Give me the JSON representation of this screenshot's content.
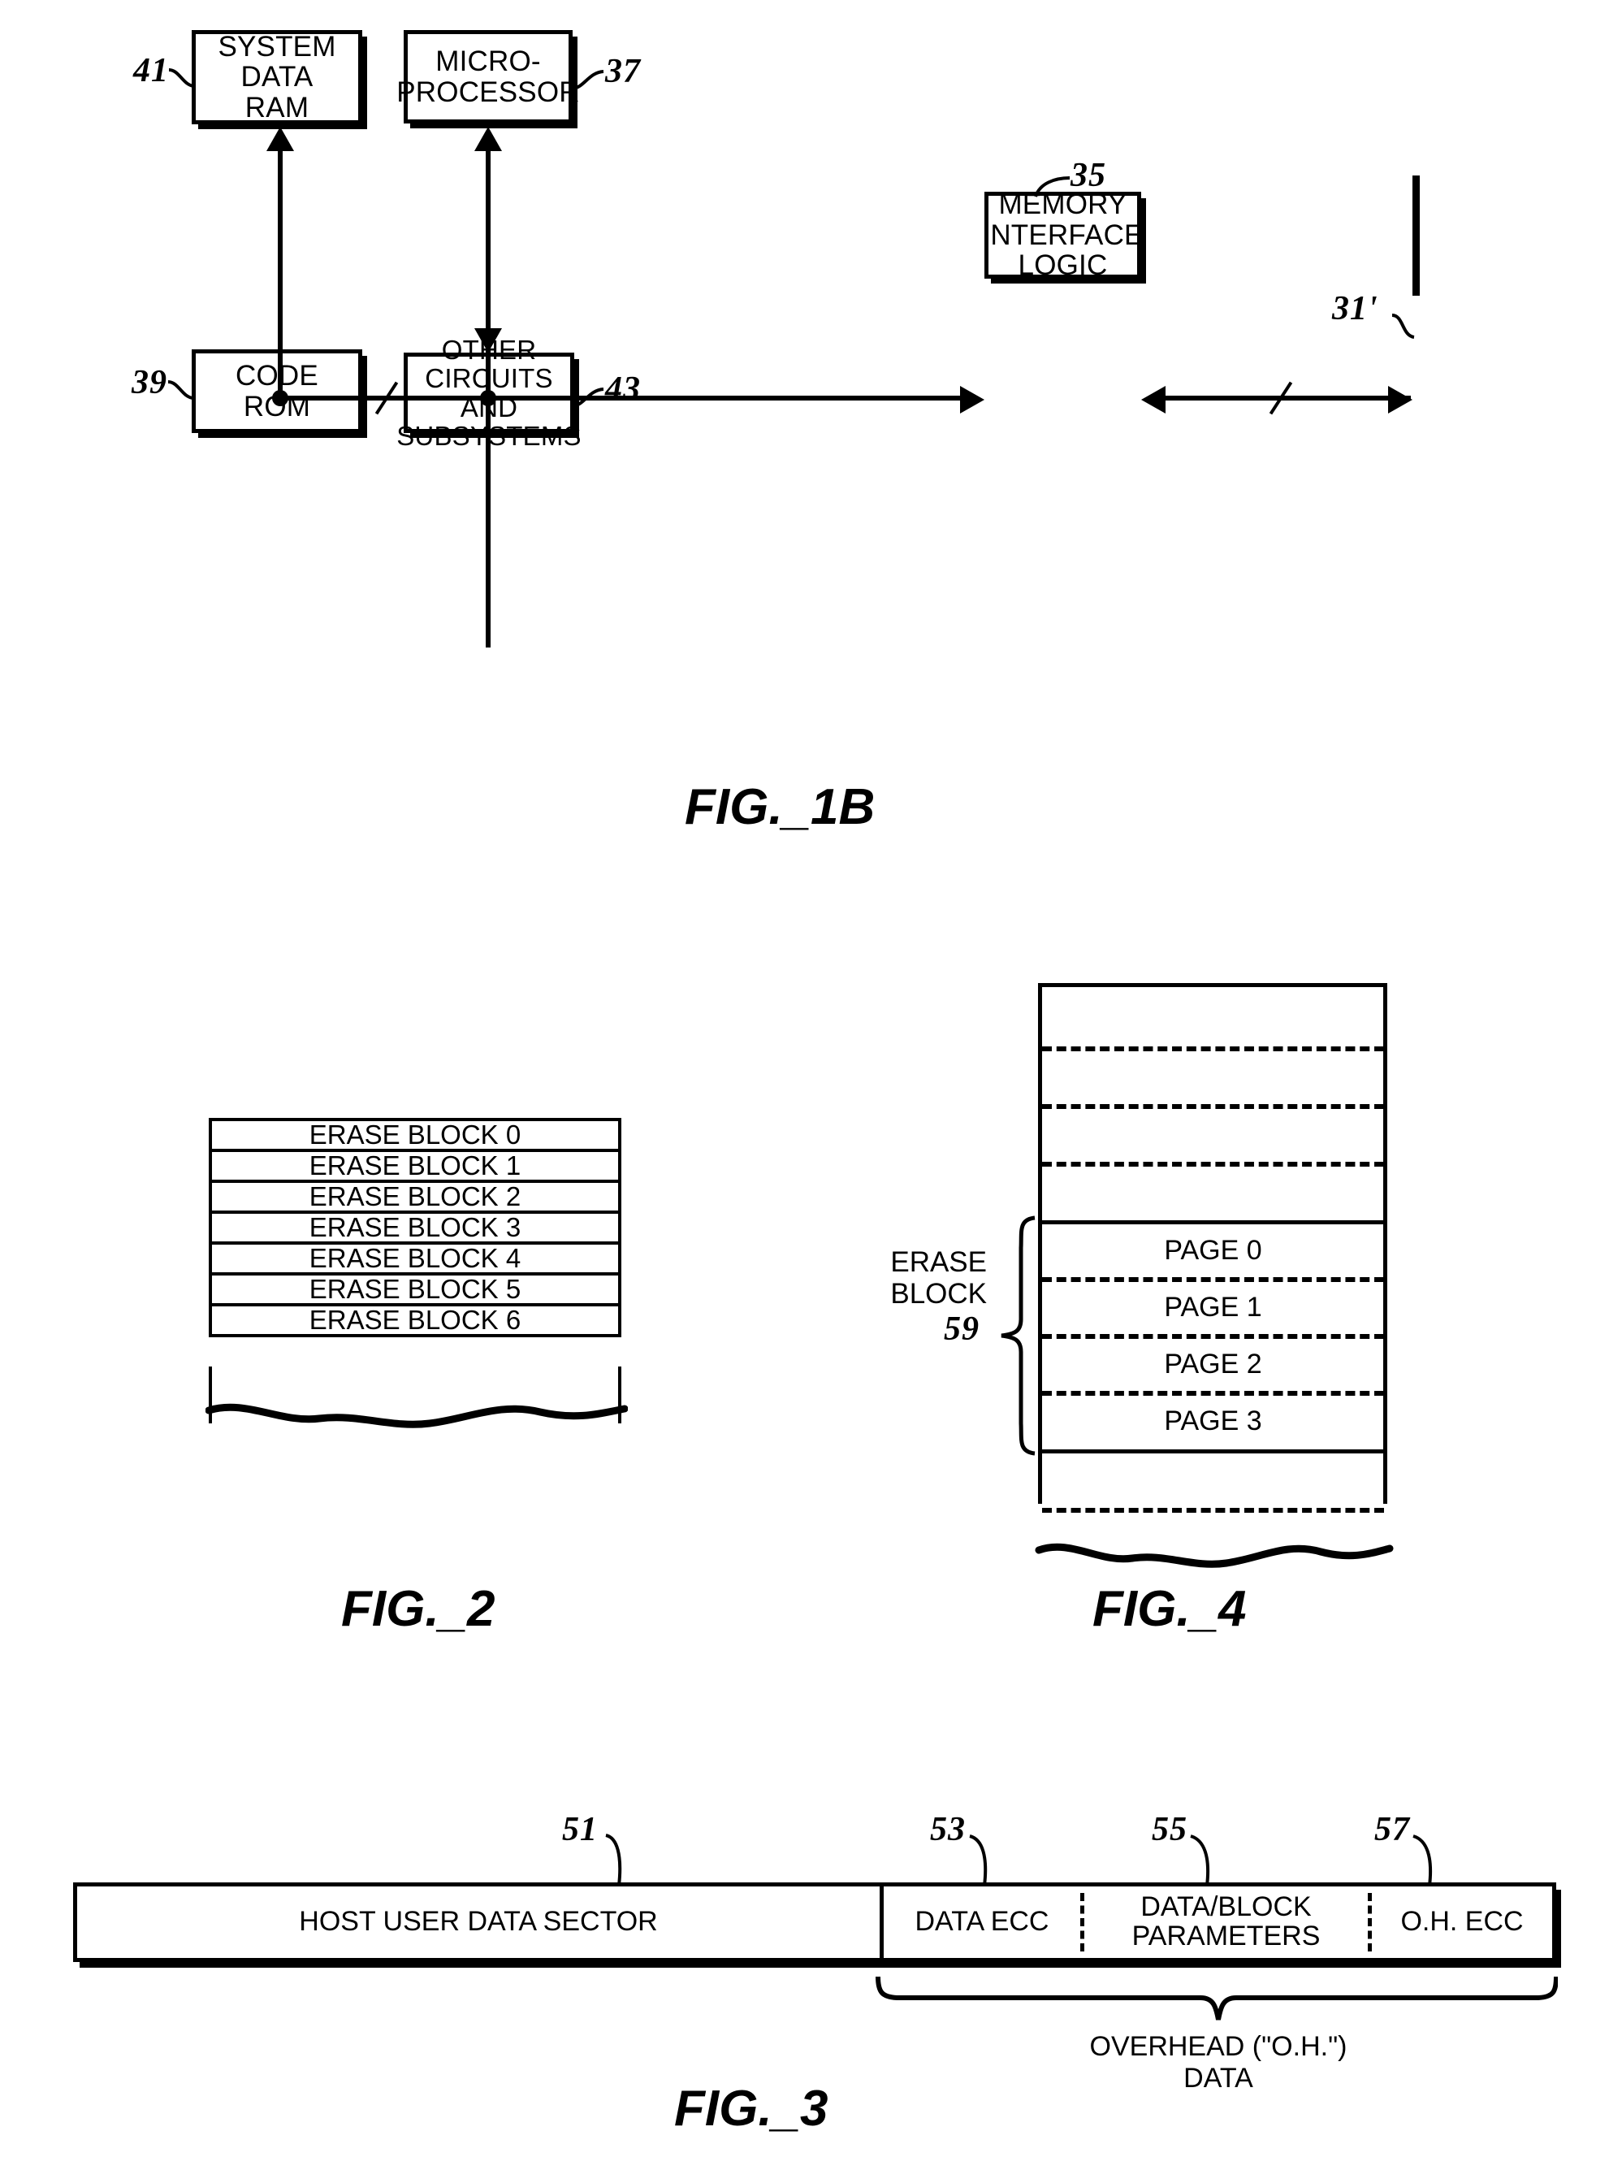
{
  "figures": {
    "fig1b": {
      "caption": "FIG._1B",
      "blocks": [
        {
          "id": "system-data-ram",
          "label": "SYSTEM\nDATA\nRAM",
          "ref": "41"
        },
        {
          "id": "microprocessor",
          "label": "MICRO-\nPROCESSOR",
          "ref": "37"
        },
        {
          "id": "memory-interface-logic",
          "label": "MEMORY\nINTERFACE\nLOGIC",
          "ref": "35"
        },
        {
          "id": "code-rom",
          "label": "CODE\nROM",
          "ref": "39"
        },
        {
          "id": "other-circuits",
          "label": "OTHER\nCIRCUITS AND\nSUBSYSTEMS",
          "ref": "43"
        }
      ],
      "bus_ref": "31'"
    },
    "fig2": {
      "caption": "FIG._2",
      "rows": [
        "ERASE BLOCK 0",
        "ERASE BLOCK 1",
        "ERASE BLOCK 2",
        "ERASE BLOCK 3",
        "ERASE BLOCK 4",
        "ERASE BLOCK 5",
        "ERASE BLOCK 6"
      ]
    },
    "fig4": {
      "caption": "FIG._4",
      "bracket_label": "ERASE\nBLOCK",
      "bracket_ref": "59",
      "pages": [
        "PAGE 0",
        "PAGE 1",
        "PAGE 2",
        "PAGE 3"
      ]
    },
    "fig3": {
      "caption": "FIG._3",
      "segments": [
        {
          "id": "host-user-data-sector",
          "label": "HOST USER DATA SECTOR",
          "ref": "51"
        },
        {
          "id": "data-ecc",
          "label": "DATA ECC",
          "ref": "53"
        },
        {
          "id": "data-block-parameters",
          "label": "DATA/BLOCK\nPARAMETERS",
          "ref": "55"
        },
        {
          "id": "oh-ecc",
          "label": "O.H. ECC",
          "ref": "57"
        }
      ],
      "overhead_label": "OVERHEAD (\"O.H.\")\nDATA"
    }
  }
}
